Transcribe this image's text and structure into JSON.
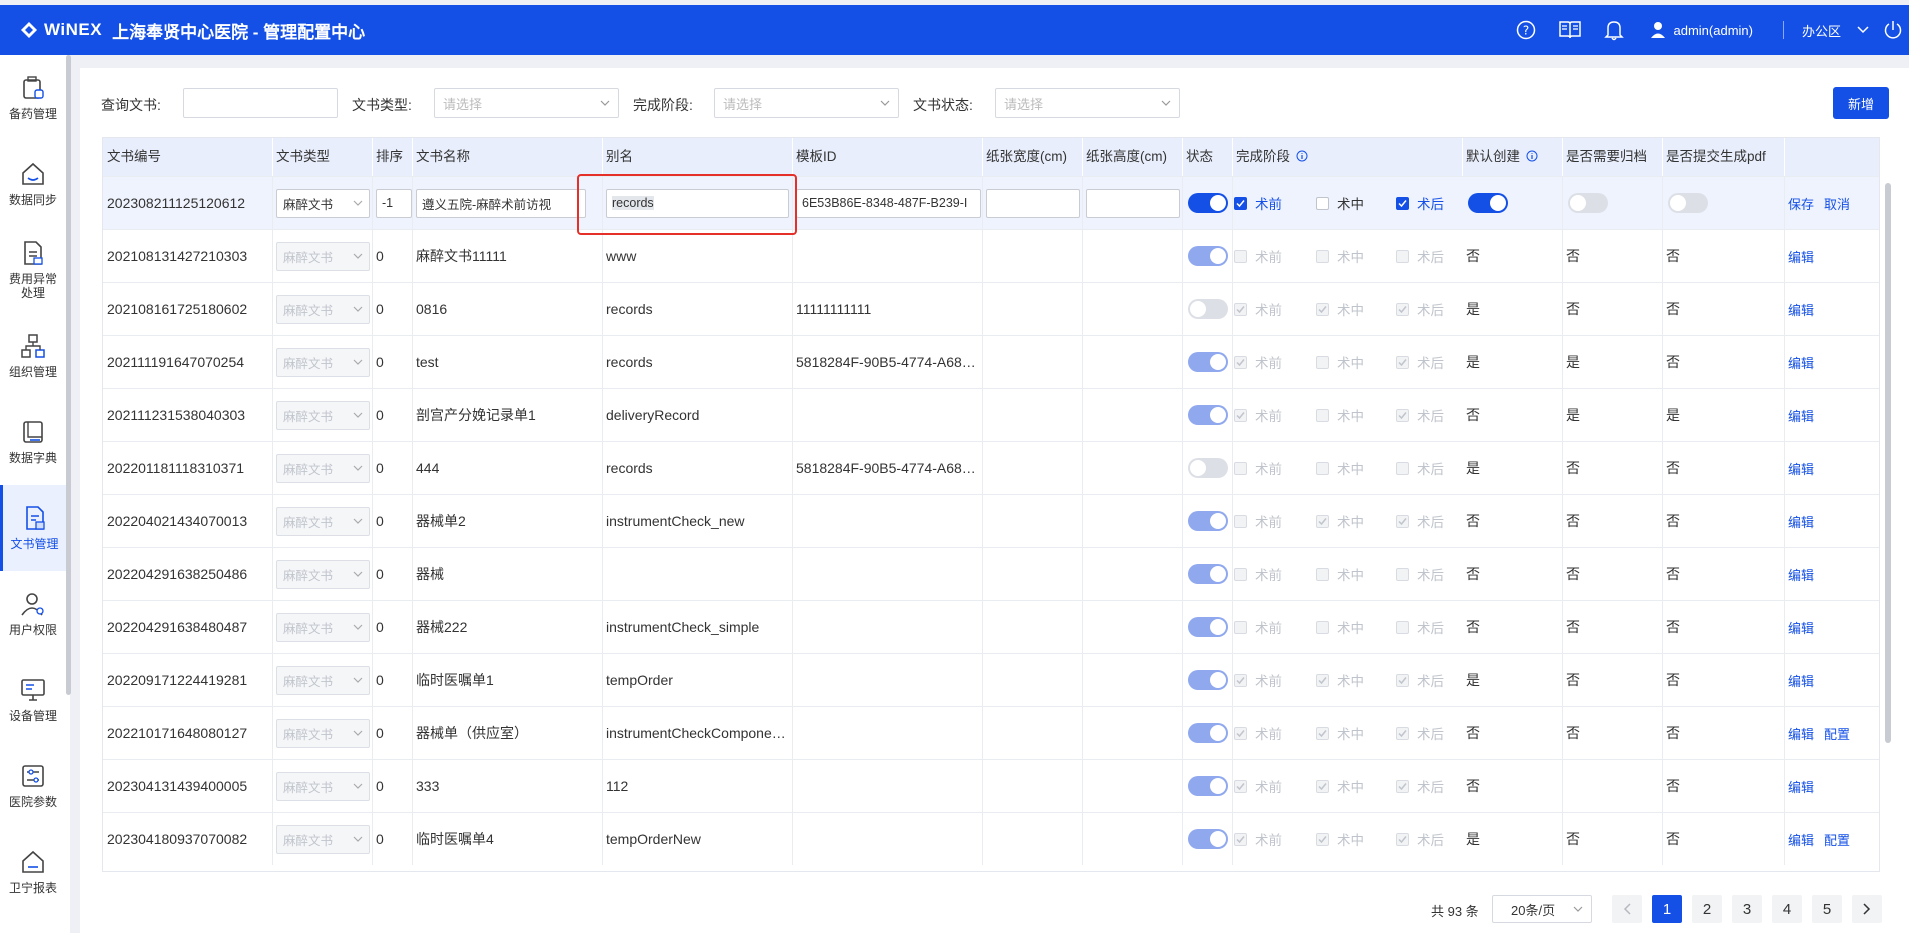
{
  "header": {
    "brand": "WiNEX",
    "title": "上海奉贤中心医院 - 管理配置中心",
    "user": "admin(admin)",
    "office": "办公区"
  },
  "sidebar": {
    "items": [
      {
        "label": "备药管理",
        "icon": "medicine-box-icon"
      },
      {
        "label": "数据同步",
        "icon": "sync-house-icon"
      },
      {
        "label": "费用异常处理",
        "icon": "document-icon"
      },
      {
        "label": "组织管理",
        "icon": "org-chart-icon"
      },
      {
        "label": "数据字典",
        "icon": "book-icon"
      },
      {
        "label": "文书管理",
        "icon": "document-manage-icon",
        "active": true
      },
      {
        "label": "用户权限",
        "icon": "user-icon"
      },
      {
        "label": "设备管理",
        "icon": "monitor-icon"
      },
      {
        "label": "医院参数",
        "icon": "settings-panel-icon"
      },
      {
        "label": "卫宁报表",
        "icon": "report-house-icon"
      }
    ]
  },
  "filters": {
    "doc_query_label": "查询文书:",
    "doc_query_value": "",
    "doc_type_label": "文书类型:",
    "doc_type_placeholder": "请选择",
    "stage_label": "完成阶段:",
    "stage_placeholder": "请选择",
    "status_label": "文书状态:",
    "status_placeholder": "请选择",
    "add_button": "新增"
  },
  "table": {
    "columns": [
      "文书编号",
      "文书类型",
      "排序",
      "文书名称",
      "别名",
      "模板ID",
      "纸张宽度(cm)",
      "纸张高度(cm)",
      "状态",
      "完成阶段",
      "默认创建",
      "是否需要归档",
      "是否提交生成pdf"
    ],
    "stage_labels": [
      "术前",
      "术中",
      "术后"
    ],
    "edit_row": {
      "code": "202308211125120612",
      "type": "麻醉文书",
      "order": "-1",
      "name": "遵义五院-麻醉术前访视",
      "alias": "records",
      "template_id": "6E53B86E-8348-487F-B239-I",
      "width": "",
      "height": "",
      "save": "保存",
      "cancel": "取消"
    },
    "rows": [
      {
        "code": "202108131427210303",
        "type": "麻醉文书",
        "order": "0",
        "name": "麻醉文书11111",
        "alias": "www",
        "template_id": "",
        "status": "on",
        "stages": [
          false,
          false,
          false
        ],
        "default": "否",
        "archive": "否",
        "pdf": "否",
        "actions": [
          "编辑"
        ]
      },
      {
        "code": "202108161725180602",
        "type": "麻醉文书",
        "order": "0",
        "name": "0816",
        "alias": "records",
        "template_id": "11111111111",
        "status": "off",
        "stages": [
          true,
          true,
          true
        ],
        "default": "是",
        "archive": "否",
        "pdf": "否",
        "actions": [
          "编辑"
        ]
      },
      {
        "code": "202111191647070254",
        "type": "麻醉文书",
        "order": "0",
        "name": "test",
        "alias": "records",
        "template_id": "5818284F-90B5-4774-A68…",
        "status": "on",
        "stages": [
          true,
          false,
          true
        ],
        "default": "是",
        "archive": "是",
        "pdf": "否",
        "actions": [
          "编辑"
        ]
      },
      {
        "code": "202111231538040303",
        "type": "麻醉文书",
        "order": "0",
        "name": "剖宫产分娩记录单1",
        "alias": "deliveryRecord",
        "template_id": "",
        "status": "on",
        "stages": [
          true,
          false,
          true
        ],
        "default": "否",
        "archive": "是",
        "pdf": "是",
        "actions": [
          "编辑"
        ]
      },
      {
        "code": "202201181118310371",
        "type": "麻醉文书",
        "order": "0",
        "name": "444",
        "alias": "records",
        "template_id": "5818284F-90B5-4774-A68…",
        "status": "off",
        "stages": [
          false,
          false,
          false
        ],
        "default": "是",
        "archive": "否",
        "pdf": "否",
        "actions": [
          "编辑"
        ]
      },
      {
        "code": "202204021434070013",
        "type": "麻醉文书",
        "order": "0",
        "name": "器械单2",
        "alias": "instrumentCheck_new",
        "template_id": "",
        "status": "on",
        "stages": [
          false,
          true,
          true
        ],
        "default": "否",
        "archive": "否",
        "pdf": "否",
        "actions": [
          "编辑"
        ]
      },
      {
        "code": "202204291638250486",
        "type": "麻醉文书",
        "order": "0",
        "name": "器械",
        "alias": "",
        "template_id": "",
        "status": "on",
        "stages": [
          false,
          false,
          false
        ],
        "default": "否",
        "archive": "否",
        "pdf": "否",
        "actions": [
          "编辑"
        ]
      },
      {
        "code": "202204291638480487",
        "type": "麻醉文书",
        "order": "0",
        "name": "器械222",
        "alias": "instrumentCheck_simple",
        "template_id": "",
        "status": "on",
        "stages": [
          false,
          false,
          false
        ],
        "default": "否",
        "archive": "否",
        "pdf": "否",
        "actions": [
          "编辑"
        ]
      },
      {
        "code": "202209171224419281",
        "type": "麻醉文书",
        "order": "0",
        "name": "临时医嘱单1",
        "alias": "tempOrder",
        "template_id": "",
        "status": "on",
        "stages": [
          true,
          true,
          true
        ],
        "default": "是",
        "archive": "否",
        "pdf": "否",
        "actions": [
          "编辑"
        ]
      },
      {
        "code": "202210171648080127",
        "type": "麻醉文书",
        "order": "0",
        "name": "器械单（供应室）",
        "alias": "instrumentCheckCompone…",
        "template_id": "",
        "status": "on",
        "stages": [
          true,
          true,
          true
        ],
        "default": "否",
        "archive": "否",
        "pdf": "否",
        "actions": [
          "编辑",
          "配置"
        ]
      },
      {
        "code": "202304131439400005",
        "type": "麻醉文书",
        "order": "0",
        "name": "333",
        "alias": "112",
        "template_id": "",
        "status": "on",
        "stages": [
          true,
          true,
          true
        ],
        "default": "否",
        "archive": "",
        "pdf": "否",
        "actions": [
          "编辑"
        ]
      },
      {
        "code": "202304180937070082",
        "type": "麻醉文书",
        "order": "0",
        "name": "临时医嘱单4",
        "alias": "tempOrderNew",
        "template_id": "",
        "status": "on",
        "stages": [
          true,
          true,
          true
        ],
        "default": "是",
        "archive": "否",
        "pdf": "否",
        "actions": [
          "编辑",
          "配置"
        ]
      }
    ]
  },
  "pagination": {
    "total": "共 93 条",
    "page_size": "20条/页",
    "pages": [
      "1",
      "2",
      "3",
      "4",
      "5"
    ],
    "current": "1"
  },
  "colors": {
    "primary": "#1450e6",
    "highlight_border": "#e5302a"
  }
}
